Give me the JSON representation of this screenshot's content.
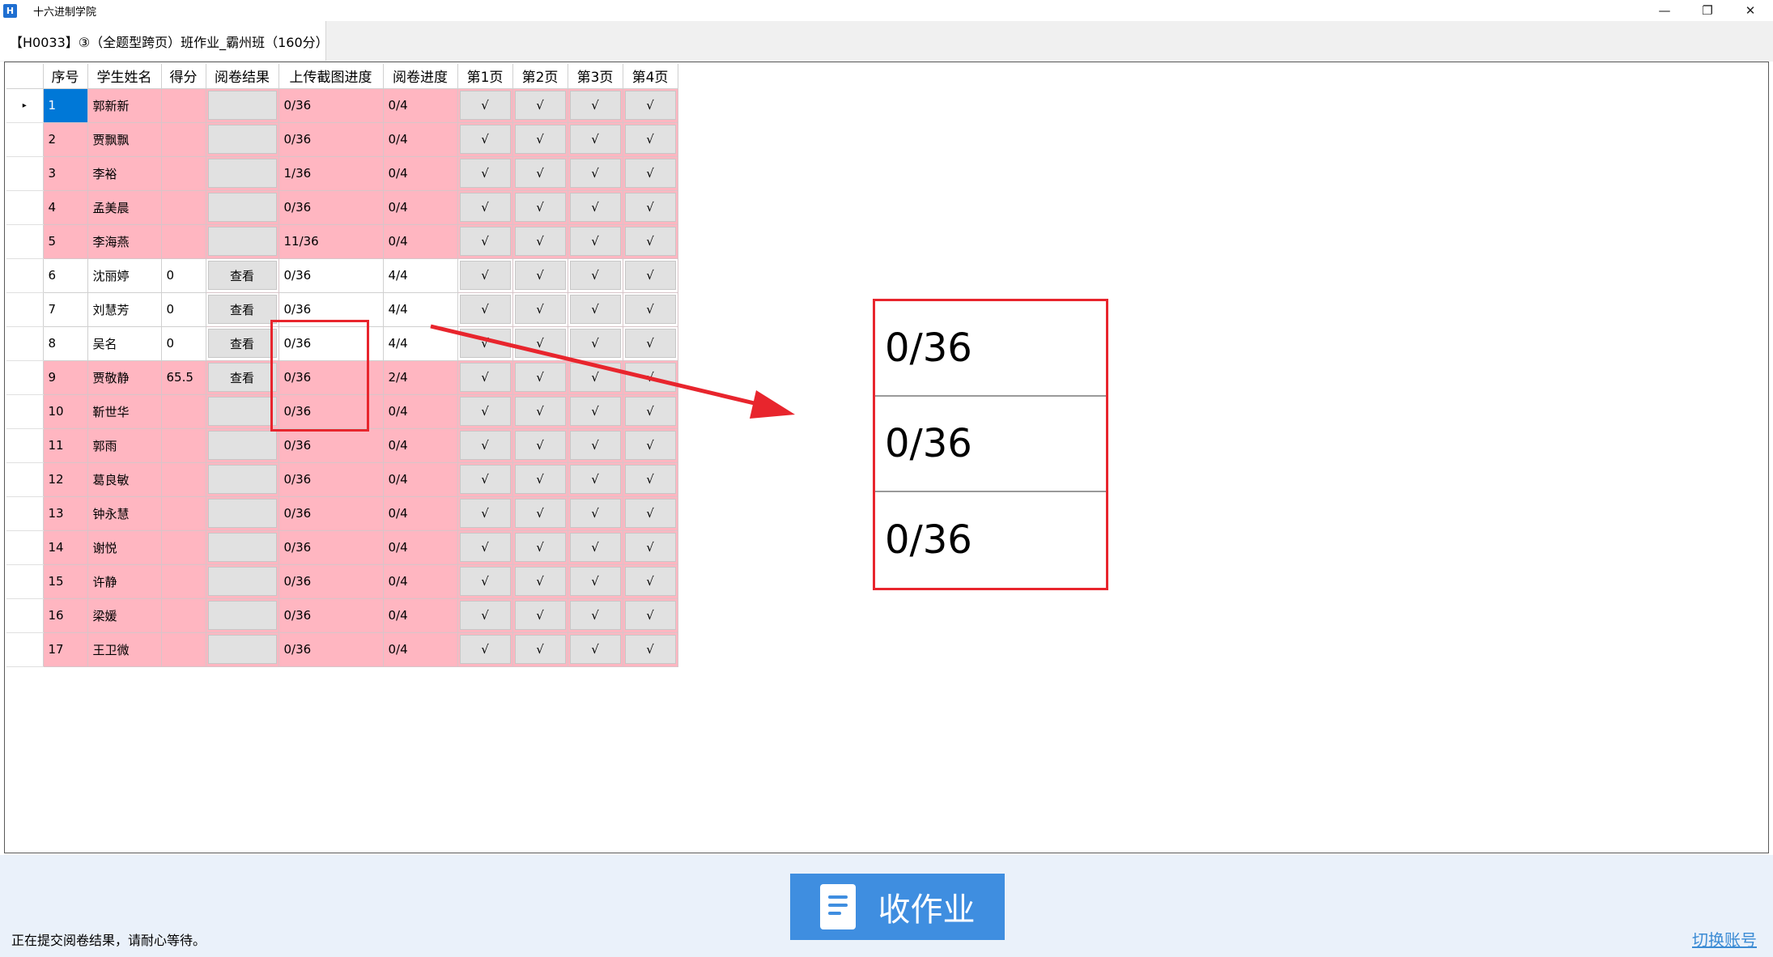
{
  "window": {
    "icon_text": "H",
    "title": "十六进制学院",
    "minimize": "—",
    "maximize": "❐",
    "close": "✕"
  },
  "tab": {
    "label": "【H0033】③（全题型跨页）班作业_霸州班（160分）"
  },
  "grid": {
    "columns": [
      "序号",
      "学生姓名",
      "得分",
      "阅卷结果",
      "上传截图进度",
      "阅卷进度",
      "第1页",
      "第2页",
      "第3页",
      "第4页"
    ],
    "rows": [
      {
        "no": "1",
        "name": "郭新新",
        "score": "",
        "view": "",
        "upload": "0/36",
        "grading": "0/4",
        "pages": [
          "√",
          "√",
          "√",
          "√"
        ],
        "style": "pink"
      },
      {
        "no": "2",
        "name": "贾飘飘",
        "score": "",
        "view": "",
        "upload": "0/36",
        "grading": "0/4",
        "pages": [
          "√",
          "√",
          "√",
          "√"
        ],
        "style": "pink"
      },
      {
        "no": "3",
        "name": "李裕",
        "score": "",
        "view": "",
        "upload": "1/36",
        "grading": "0/4",
        "pages": [
          "√",
          "√",
          "√",
          "√"
        ],
        "style": "pink"
      },
      {
        "no": "4",
        "name": "孟美晨",
        "score": "",
        "view": "",
        "upload": "0/36",
        "grading": "0/4",
        "pages": [
          "√",
          "√",
          "√",
          "√"
        ],
        "style": "pink"
      },
      {
        "no": "5",
        "name": "李海燕",
        "score": "",
        "view": "",
        "upload": "11/36",
        "grading": "0/4",
        "pages": [
          "√",
          "√",
          "√",
          "√"
        ],
        "style": "pink"
      },
      {
        "no": "6",
        "name": "沈丽婷",
        "score": "0",
        "view": "查看",
        "upload": "0/36",
        "grading": "4/4",
        "pages": [
          "√",
          "√",
          "√",
          "√"
        ],
        "style": "white"
      },
      {
        "no": "7",
        "name": "刘慧芳",
        "score": "0",
        "view": "查看",
        "upload": "0/36",
        "grading": "4/4",
        "pages": [
          "√",
          "√",
          "√",
          "√"
        ],
        "style": "white"
      },
      {
        "no": "8",
        "name": "吴名",
        "score": "0",
        "view": "查看",
        "upload": "0/36",
        "grading": "4/4",
        "pages": [
          "√",
          "√",
          "√",
          "√"
        ],
        "style": "white"
      },
      {
        "no": "9",
        "name": "贾敬静",
        "score": "65.5",
        "view": "查看",
        "upload": "0/36",
        "grading": "2/4",
        "pages": [
          "√",
          "√",
          "√",
          "√"
        ],
        "style": "pink"
      },
      {
        "no": "10",
        "name": "靳世华",
        "score": "",
        "view": "",
        "upload": "0/36",
        "grading": "0/4",
        "pages": [
          "√",
          "√",
          "√",
          "√"
        ],
        "style": "pink"
      },
      {
        "no": "11",
        "name": "郭雨",
        "score": "",
        "view": "",
        "upload": "0/36",
        "grading": "0/4",
        "pages": [
          "√",
          "√",
          "√",
          "√"
        ],
        "style": "pink"
      },
      {
        "no": "12",
        "name": "葛良敏",
        "score": "",
        "view": "",
        "upload": "0/36",
        "grading": "0/4",
        "pages": [
          "√",
          "√",
          "√",
          "√"
        ],
        "style": "pink"
      },
      {
        "no": "13",
        "name": "钟永慧",
        "score": "",
        "view": "",
        "upload": "0/36",
        "grading": "0/4",
        "pages": [
          "√",
          "√",
          "√",
          "√"
        ],
        "style": "pink"
      },
      {
        "no": "14",
        "name": "谢悦",
        "score": "",
        "view": "",
        "upload": "0/36",
        "grading": "0/4",
        "pages": [
          "√",
          "√",
          "√",
          "√"
        ],
        "style": "pink"
      },
      {
        "no": "15",
        "name": "许静",
        "score": "",
        "view": "",
        "upload": "0/36",
        "grading": "0/4",
        "pages": [
          "√",
          "√",
          "√",
          "√"
        ],
        "style": "pink"
      },
      {
        "no": "16",
        "name": "梁媛",
        "score": "",
        "view": "",
        "upload": "0/36",
        "grading": "0/4",
        "pages": [
          "√",
          "√",
          "√",
          "√"
        ],
        "style": "pink"
      },
      {
        "no": "17",
        "name": "王卫微",
        "score": "",
        "view": "",
        "upload": "0/36",
        "grading": "0/4",
        "pages": [
          "√",
          "√",
          "√",
          "√"
        ],
        "style": "pink"
      }
    ],
    "current_row_marker": "▸"
  },
  "zoom_callout": {
    "values": [
      "0/36",
      "0/36",
      "0/36"
    ]
  },
  "bottom": {
    "collect_label": "收作业",
    "status": "正在提交阅卷结果，请耐心等待。",
    "switch_account": "切换账号"
  },
  "colors": {
    "pink_row": "#ffb6c1",
    "selected_cell": "#0078d7",
    "annotation_red": "#e8252d",
    "collect_button": "#3f8ee0",
    "bottom_bar": "#eaf1fa",
    "link": "#3b8bd4"
  }
}
